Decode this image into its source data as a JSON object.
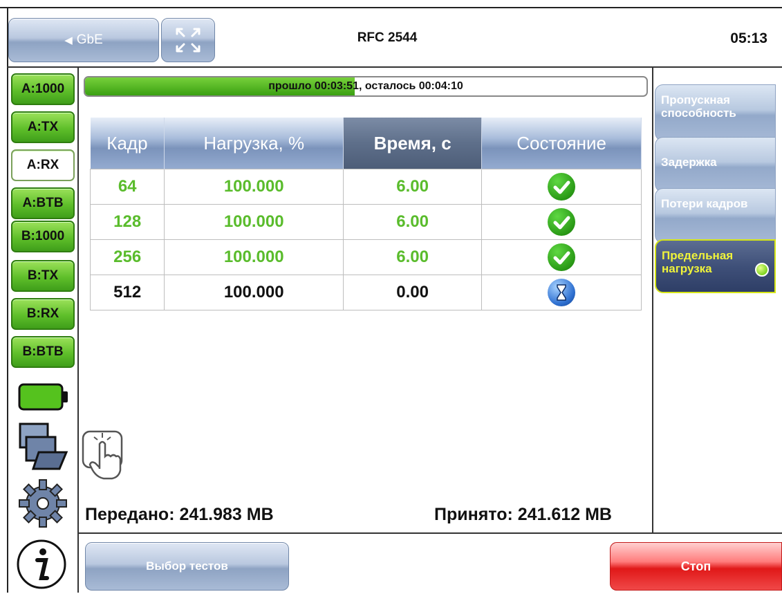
{
  "header": {
    "back_label": "GbE",
    "title": "RFC 2544",
    "time": "05:13"
  },
  "ports": [
    "A:1000",
    "A:TX",
    "A:RX",
    "A:BTB",
    "B:1000",
    "B:TX",
    "B:RX",
    "B:BTB"
  ],
  "progress": {
    "text_elapsed": "прошло 00:03:51",
    "text_remaining": ", осталось 00:04:10",
    "fraction": 0.48
  },
  "table": {
    "headers": [
      "Кадр",
      "Нагрузка, %",
      "Время, с",
      "Состояние"
    ],
    "rows": [
      {
        "frame": "64",
        "load": "100.000",
        "time": "6.00",
        "state": "ok"
      },
      {
        "frame": "128",
        "load": "100.000",
        "time": "6.00",
        "state": "ok"
      },
      {
        "frame": "256",
        "load": "100.000",
        "time": "6.00",
        "state": "ok"
      },
      {
        "frame": "512",
        "load": "100.000",
        "time": "0.00",
        "state": "in-progress"
      }
    ]
  },
  "tabs": [
    {
      "label": "Пропускная способность"
    },
    {
      "label": "Задержка"
    },
    {
      "label": "Потери кадров"
    },
    {
      "label": "Предельная нагрузка",
      "active": true
    }
  ],
  "stats": {
    "sent": "Передано: 241.983 MB",
    "received": "Принято: 241.612 MB"
  },
  "buttons": {
    "select_tests": "Выбор тестов",
    "stop": "Стоп"
  },
  "icons": {
    "battery": "battery-icon",
    "windows": "windows-icon",
    "settings": "gear-icon",
    "info": "info-icon",
    "touch": "touch-icon"
  },
  "colors": {
    "ok": "#5abc2c",
    "accent_active_tab": "#f0f33a",
    "stop": "#e01818"
  }
}
